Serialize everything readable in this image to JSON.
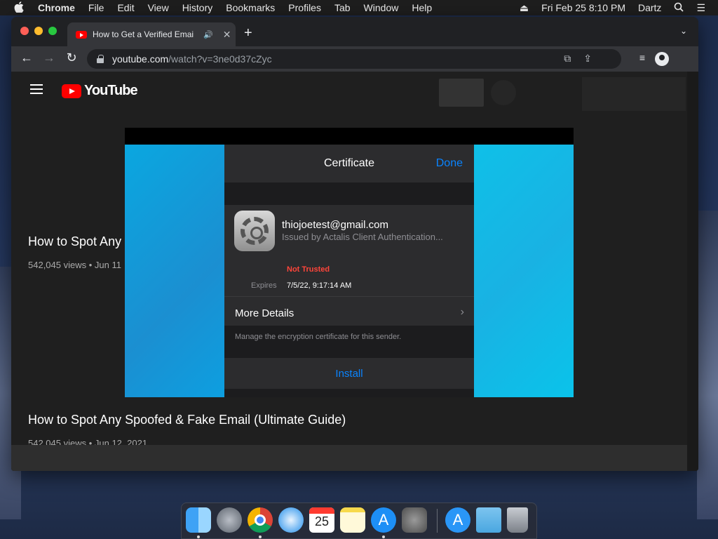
{
  "menubar": {
    "app": "Chrome",
    "items": [
      "File",
      "Edit",
      "View",
      "History",
      "Bookmarks",
      "Profiles",
      "Tab",
      "Window",
      "Help"
    ],
    "datetime": "Fri Feb 25  8:10 PM",
    "user": "Dartz"
  },
  "browser": {
    "tab_title": "How to Get a Verified Emai",
    "url_host": "youtube.com",
    "url_path": "/watch?v=3ne0d37cZyc"
  },
  "youtube": {
    "logo_text": "YouTube",
    "video_title_short": "How to Spot Any",
    "video_meta_short": "542,045 views • Jun 11",
    "video_title": "How to Spot Any Spoofed & Fake Email (Ultimate Guide)",
    "video_meta": "542,045 views • Jun 12, 2021"
  },
  "certificate_sheet": {
    "title": "Certificate",
    "done_label": "Done",
    "email": "thiojoetest@gmail.com",
    "issued_by": "Issued by Actalis Client Authentication...",
    "trust_status": "Not Trusted",
    "expires_label": "Expires",
    "expires_value": "7/5/22, 9:17:14 AM",
    "more_details": "More Details",
    "manage_note": "Manage the encryption certificate for this sender.",
    "install_label": "Install"
  },
  "dock": {
    "calendar_day": "25",
    "calendar_month": "FEB"
  },
  "colors": {
    "accent_blue": "#0a84ff",
    "not_trusted_red": "#ff453a",
    "youtube_red": "#ff0000"
  }
}
